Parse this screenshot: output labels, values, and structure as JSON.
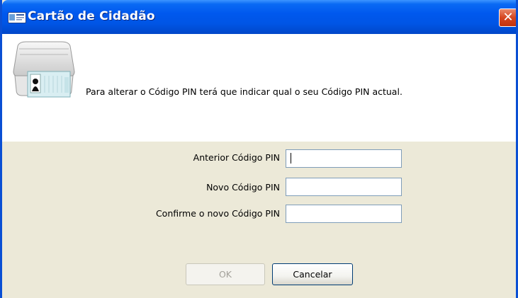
{
  "window": {
    "title": "Cartão de Cidadão",
    "close_label": "✕"
  },
  "header": {
    "message": "Para alterar o Código PIN terá que indicar qual o seu Código PIN actual.",
    "image_icon": "card-reader-icon"
  },
  "form": {
    "old_pin_label": "Anterior Código PIN",
    "old_pin_value": "",
    "new_pin_label": "Novo Código PIN",
    "new_pin_value": "",
    "confirm_pin_label": "Confirme o novo Código PIN",
    "confirm_pin_value": ""
  },
  "buttons": {
    "ok_label": "OK",
    "ok_enabled": false,
    "cancel_label": "Cancelar"
  },
  "colors": {
    "titlebar": "#0055e5",
    "dialog_background": "#ece9d8",
    "input_border": "#7f9db9"
  }
}
